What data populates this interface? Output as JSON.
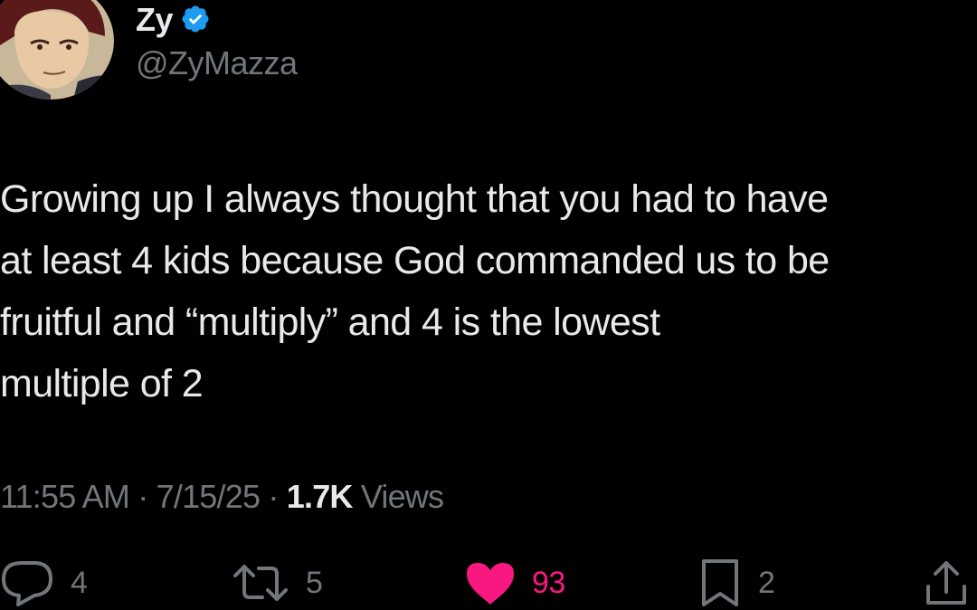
{
  "colors": {
    "background": "#000000",
    "text_primary": "#e7e9ea",
    "text_secondary": "#71767b",
    "verified_blue": "#1d9bf0",
    "like_pink": "#f91880"
  },
  "author": {
    "display_name": "Zy",
    "handle": "@ZyMazza",
    "verified_icon": "verified-badge-icon",
    "avatar_icon": "anime-avatar"
  },
  "tweet": {
    "lines": [
      "Growing up I always thought that you had to have",
      "at least 4 kids because God commanded us to be",
      "fruitful and “multiply” and 4 is the lowest",
      "multiple of 2"
    ]
  },
  "meta": {
    "time": "11:55 AM",
    "separator": "·",
    "date": "7/15/25",
    "views_count": "1.7K",
    "views_label": "Views"
  },
  "actions": {
    "reply": {
      "icon": "reply-icon",
      "count": "4"
    },
    "retweet": {
      "icon": "retweet-icon",
      "count": "5"
    },
    "like": {
      "icon": "heart-icon",
      "count": "93",
      "liked": true
    },
    "bookmark": {
      "icon": "bookmark-icon",
      "count": "2"
    },
    "share": {
      "icon": "share-icon"
    }
  }
}
